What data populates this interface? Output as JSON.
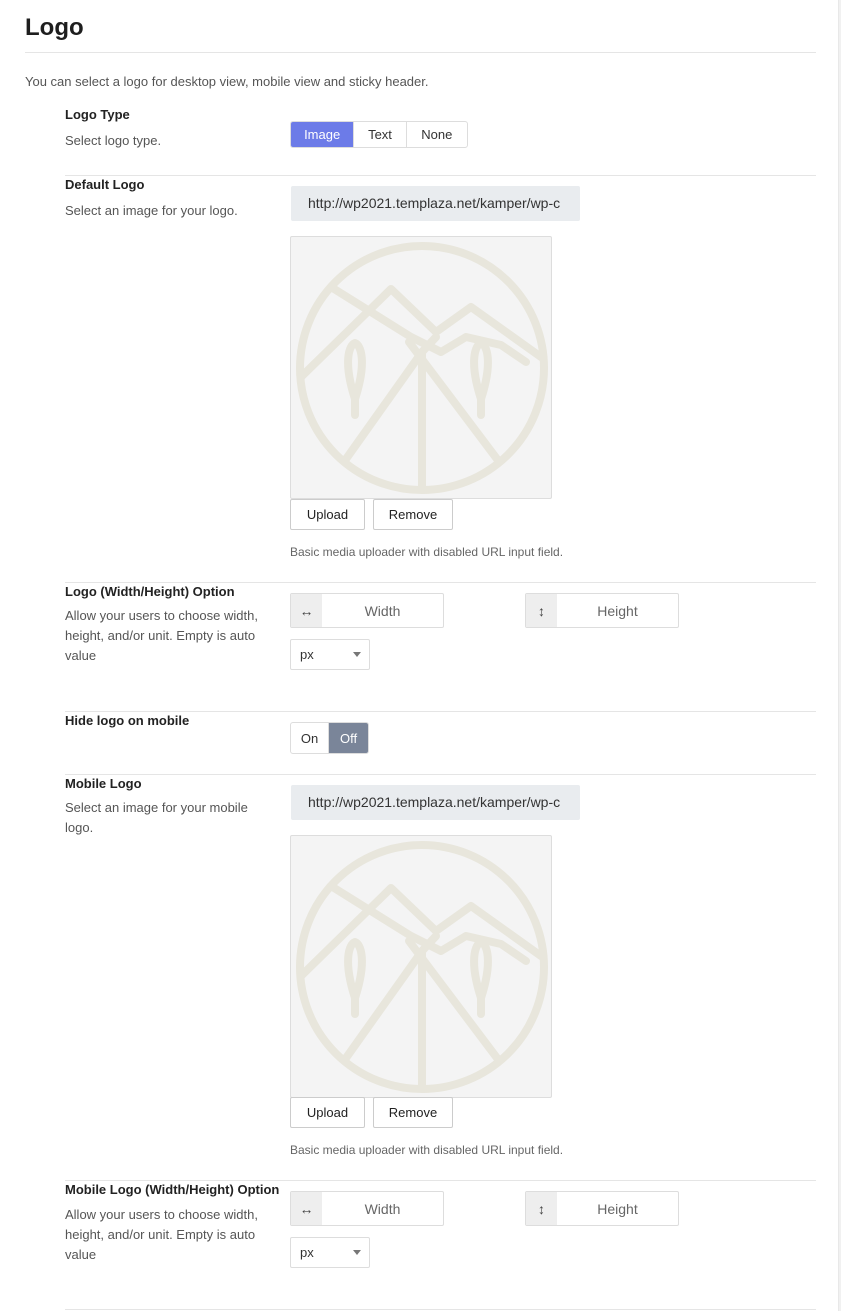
{
  "section": {
    "title": "Logo",
    "intro": "You can select a logo for desktop view, mobile view and sticky header."
  },
  "logo_type": {
    "label": "Logo Type",
    "desc": "Select logo type.",
    "options": [
      "Image",
      "Text",
      "None"
    ],
    "selected": "Image"
  },
  "default_logo": {
    "label": "Default Logo",
    "desc": "Select an image for your logo.",
    "url": "http://wp2021.templaza.net/kamper/wp-c",
    "upload": "Upload",
    "remove": "Remove",
    "help": "Basic media uploader with disabled URL input field."
  },
  "logo_size": {
    "label": "Logo (Width/Height) Option",
    "desc": "Allow your users to choose width, height, and/or unit. Empty is auto value",
    "width_placeholder": "Width",
    "height_placeholder": "Height",
    "unit": "px",
    "width_icon": "horizontal-arrows-icon",
    "height_icon": "vertical-arrows-icon"
  },
  "hide_mobile": {
    "label": "Hide logo on mobile",
    "on": "On",
    "off": "Off",
    "selected": "Off"
  },
  "mobile_logo": {
    "label": "Mobile Logo",
    "desc": "Select an image for your mobile logo.",
    "url": "http://wp2021.templaza.net/kamper/wp-c",
    "upload": "Upload",
    "remove": "Remove",
    "help": "Basic media uploader with disabled URL input field."
  },
  "mobile_logo_size": {
    "label": "Mobile Logo (Width/Height) Option",
    "desc": "Allow your users to choose width, height, and/or unit. Empty is auto value",
    "width_placeholder": "Width",
    "height_placeholder": "Height",
    "unit": "px"
  },
  "colors": {
    "accent": "#6c7be8",
    "toggle_active": "#7a8599",
    "logo_line": "#e8e6dc"
  }
}
